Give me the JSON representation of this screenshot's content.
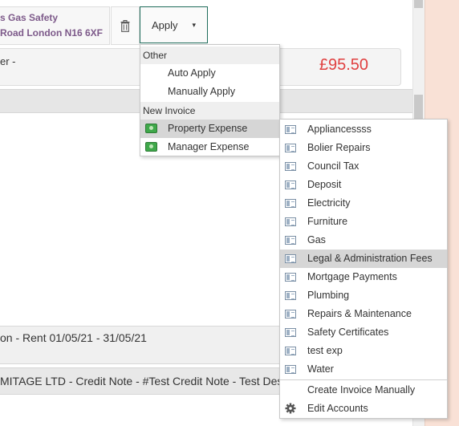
{
  "property": {
    "line1": "s Gas Safety",
    "line2": "Road London N16 6XF"
  },
  "apply_button": {
    "label": "Apply",
    "caret": "▾"
  },
  "amount": {
    "label": "er -",
    "value": "£95.50"
  },
  "rows": [
    "on - Rent 01/05/21 - 31/05/21",
    "MITAGE LTD - Credit Note - #Test Credit Note - Test Descr"
  ],
  "apply_menu": {
    "header_other": "Other",
    "auto_apply": "Auto Apply",
    "manually_apply": "Manually Apply",
    "header_new_invoice": "New Invoice",
    "property_expense": "Property Expense",
    "manager_expense": "Manager Expense"
  },
  "sub_menu": {
    "items": [
      "Appliancessss",
      "Bolier Repairs",
      "Council Tax",
      "Deposit",
      "Electricity",
      "Furniture",
      "Gas",
      "Legal & Administration Fees",
      "Mortgage Payments",
      "Plumbing",
      "Repairs & Maintenance",
      "Safety Certificates",
      "test exp",
      "Water"
    ],
    "highlighted_index": 7,
    "create_manual": "Create Invoice Manually",
    "edit_accounts": "Edit Accounts"
  },
  "colors": {
    "accent_green": "#1e6b5a",
    "amount_red": "#e04040",
    "title_purple": "#7d5a8a",
    "highlight_grey": "#d6d6d6"
  },
  "icons": {
    "trash": "trash-icon",
    "money": "money-icon",
    "ledger": "ledger-icon",
    "gear": "gear-icon"
  }
}
